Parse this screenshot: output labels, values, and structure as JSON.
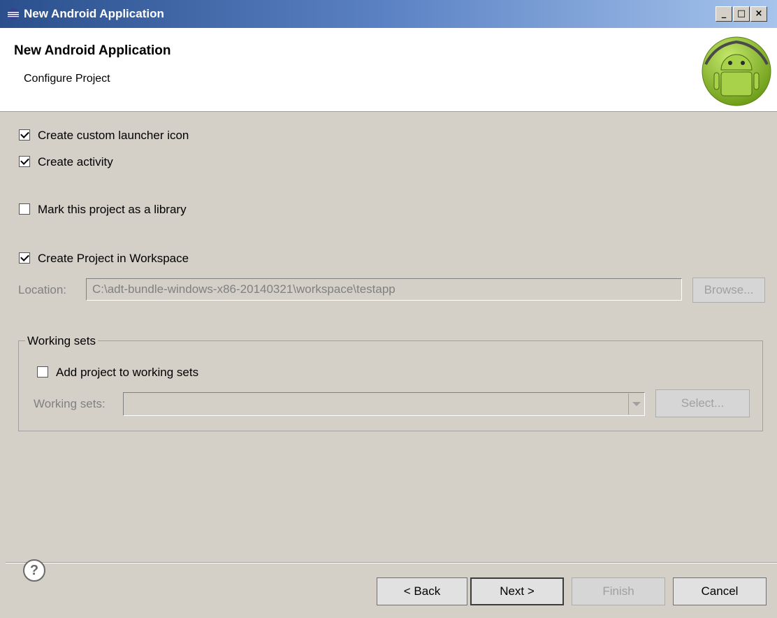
{
  "window": {
    "title": "New Android Application"
  },
  "header": {
    "title": "New Android Application",
    "subtitle": "Configure Project"
  },
  "options": {
    "custom_launcher": {
      "label": "Create custom launcher icon",
      "checked": true
    },
    "create_activity": {
      "label": "Create activity",
      "checked": true
    },
    "mark_library": {
      "label": "Mark this project as a library",
      "checked": false
    },
    "in_workspace": {
      "label": "Create Project in Workspace",
      "checked": true
    }
  },
  "location": {
    "label": "Location:",
    "value": "C:\\adt-bundle-windows-x86-20140321\\workspace\\testapp",
    "browse_label": "Browse..."
  },
  "working_sets": {
    "group_label": "Working sets",
    "add_label": "Add project to working sets",
    "add_checked": false,
    "field_label": "Working sets:",
    "value": "",
    "select_label": "Select..."
  },
  "footer": {
    "back": "< Back",
    "next": "Next >",
    "finish": "Finish",
    "cancel": "Cancel",
    "help_icon": "?"
  }
}
